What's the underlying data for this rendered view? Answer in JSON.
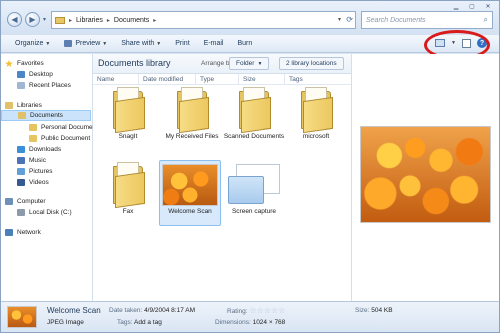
{
  "address": {
    "crumbs": [
      "Libraries",
      "Documents"
    ]
  },
  "search": {
    "placeholder": "Search Documents"
  },
  "toolbar": {
    "organize": "Organize",
    "preview": "Preview",
    "share_with": "Share with",
    "print": "Print",
    "email": "E-mail",
    "burn": "Burn"
  },
  "nav": {
    "favorites": "Favorites",
    "desktop": "Desktop",
    "recent_places": "Recent Places",
    "libraries": "Libraries",
    "documents": "Documents",
    "personal_documents": "Personal Docume",
    "public_documents": "Public Document",
    "downloads": "Downloads",
    "music": "Music",
    "pictures": "Pictures",
    "videos": "Videos",
    "computer": "Computer",
    "local_disk": "Local Disk (C:)",
    "network": "Network"
  },
  "library": {
    "title": "Documents library",
    "arrange_by_label": "Arrange by:",
    "arrange_value": "Folder",
    "locations_button": "2 library locations"
  },
  "columns": [
    "Name",
    "Date modified",
    "Type",
    "Size",
    "Tags"
  ],
  "items": [
    {
      "label": "SnagIt",
      "kind": "folder"
    },
    {
      "label": "My Received Files",
      "kind": "folder"
    },
    {
      "label": "Scanned Documents",
      "kind": "folder"
    },
    {
      "label": "microsoft",
      "kind": "folder"
    },
    {
      "label": "Fax",
      "kind": "folder"
    },
    {
      "label": "Welcome Scan",
      "kind": "image"
    },
    {
      "label": "Screen capture",
      "kind": "image"
    }
  ],
  "details": {
    "name": "Welcome Scan",
    "type": "JPEG Image",
    "date_taken_label": "Date taken:",
    "date_taken": "4/9/2004 8:17 AM",
    "tags_label": "Tags:",
    "tags": "Add a tag",
    "rating_label": "Rating:",
    "rating": 0,
    "dimensions_label": "Dimensions:",
    "dimensions": "1024 × 768",
    "size_label": "Size:",
    "size": "504 KB"
  },
  "colors": {
    "highlight_ring": "#d81a1a",
    "selection": "#cce4fb",
    "folder": "#e5c462"
  }
}
